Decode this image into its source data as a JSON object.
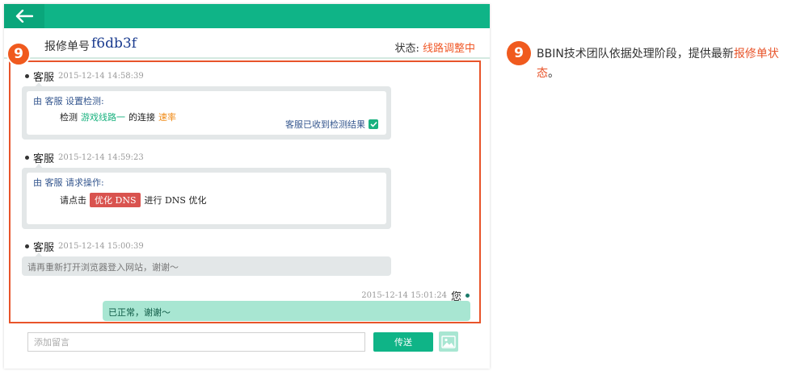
{
  "header": {
    "ticket_label": "报修单号",
    "ticket_id": "f6db3f",
    "status_label": "状态:",
    "status_value": "线路调整中"
  },
  "badge": "9",
  "messages": [
    {
      "sender": "客服",
      "time": "2015-12-14 14:58:39",
      "title": "由 客服 设置检测:",
      "line_prefix": "检测",
      "line_route": "游戏线路一",
      "line_mid": "的连接",
      "line_metric": "速率",
      "received": "客服已收到检测结果"
    },
    {
      "sender": "客服",
      "time": "2015-12-14 14:59:23",
      "title": "由 客服 请求操作:",
      "line_prefix": "请点击",
      "line_button": "优化 DNS",
      "line_suffix": "进行 DNS 优化"
    },
    {
      "sender": "客服",
      "time": "2015-12-14 15:00:39",
      "text": "请再重新打开浏览器登入网站，谢谢～"
    },
    {
      "sender": "您",
      "time": "2015-12-14 15:01:24",
      "text": "已正常，谢谢～"
    }
  ],
  "composer": {
    "placeholder": "添加留言",
    "send_label": "传送"
  },
  "note": {
    "text_before": "BBIN技术团队依据处理阶段，提供最新",
    "text_highlight": "报修单状态",
    "text_after": "。"
  },
  "colors": {
    "brand_green": "#0fb487",
    "highlight_orange": "#e8542a"
  }
}
